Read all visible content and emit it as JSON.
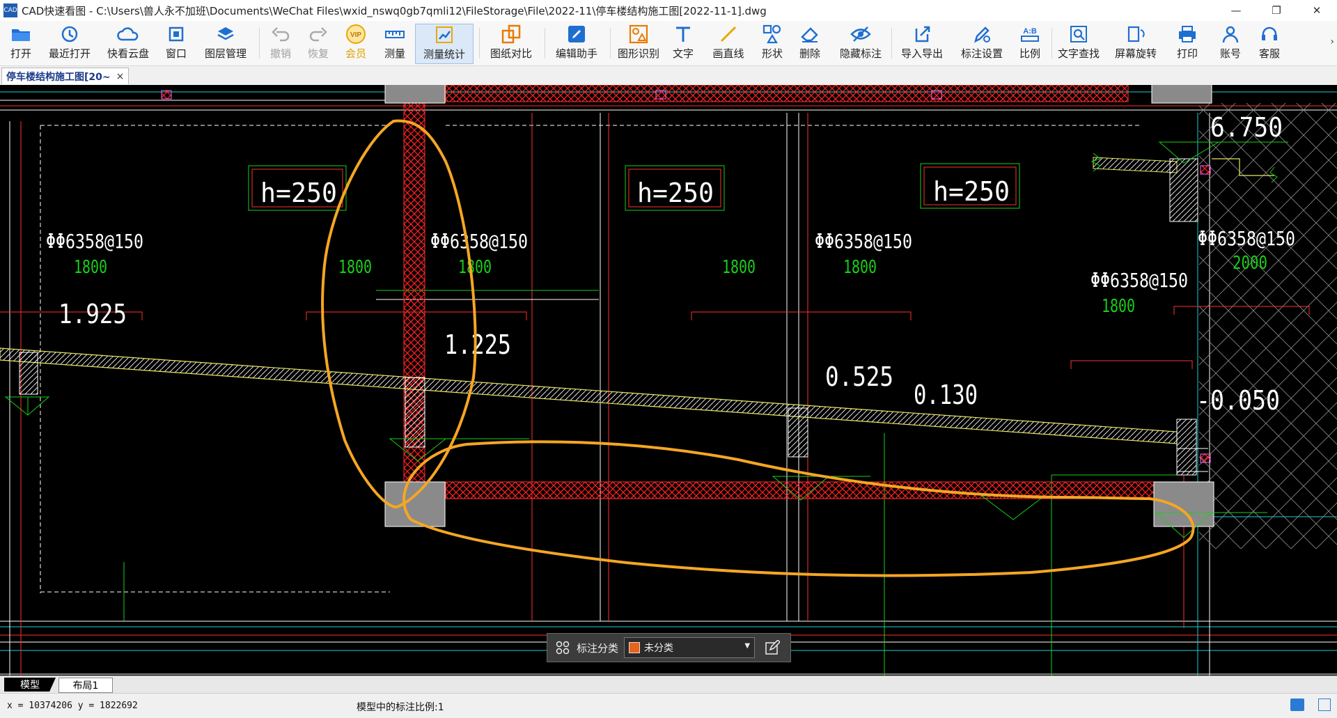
{
  "window": {
    "title": "CAD快速看图 - C:\\Users\\兽人永不加班\\Documents\\WeChat Files\\wxid_nswq0gb7qmli12\\FileStorage\\File\\2022-11\\停车楼结构施工图[2022-11-1].dwg",
    "app_icon_text": "CAD"
  },
  "toolbar": {
    "open": "打开",
    "recent": "最近打开",
    "cloud": "快看云盘",
    "window": "窗口",
    "layers": "图层管理",
    "undo": "撤销",
    "redo": "恢复",
    "vip": "会员",
    "measure": "测量",
    "measure_stats": "测量统计",
    "compare": "图纸对比",
    "edit_helper": "编辑助手",
    "shape_recog": "图形识别",
    "text": "文字",
    "line": "画直线",
    "shape": "形状",
    "delete": "删除",
    "hide_ann": "隐藏标注",
    "import_export": "导入导出",
    "ann_settings": "标注设置",
    "scale": "比例",
    "text_search": "文字查找",
    "rotate": "屏幕旋转",
    "print": "打印",
    "account": "账号",
    "service": "客服",
    "vip_badge": "VIP",
    "scale_badge": "A:B"
  },
  "doc_tab": {
    "label": "停车楼结构施工图[20~",
    "close": "×"
  },
  "drawing": {
    "slab_labels": [
      "h=250",
      "h=250",
      "h=250"
    ],
    "rebar_labels": [
      "ΦΦ6358@150",
      "ΦΦ6358@150",
      "ΦΦ6358@150",
      "ΦΦ6358@150",
      "ΦΦ6358@150"
    ],
    "dims": [
      "1800",
      "1800",
      "1800",
      "1800",
      "1800",
      "2000",
      "1800"
    ],
    "elevations": [
      "6.750",
      "1.925",
      "1.225",
      "0.525",
      "0.130",
      "-0.050"
    ]
  },
  "annotation_bar": {
    "label": "标注分类",
    "selected": "未分类",
    "swatch_color": "#e8631a"
  },
  "layout_tabs": [
    "模型",
    "布局1"
  ],
  "status": {
    "coords": "x = 10374206  y = 1822692",
    "scale_text": "模型中的标注比例:1"
  },
  "colors": {
    "highlight": "#f5a623",
    "hatch": "#ff2020",
    "dim_green": "#18d018",
    "wall_gray": "#8a8a8a"
  }
}
